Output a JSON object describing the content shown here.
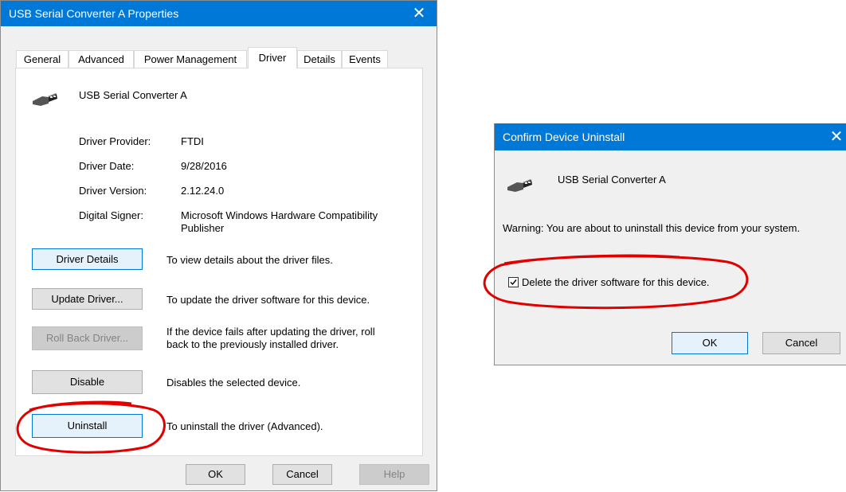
{
  "props_dialog": {
    "title": "USB Serial Converter A Properties",
    "tabs": [
      {
        "label": "General"
      },
      {
        "label": "Advanced"
      },
      {
        "label": "Power Management"
      },
      {
        "label": "Driver"
      },
      {
        "label": "Details"
      },
      {
        "label": "Events"
      }
    ],
    "active_tab": "Driver",
    "device_name": "USB Serial Converter A",
    "info": {
      "provider_label": "Driver Provider:",
      "provider_value": "FTDI",
      "date_label": "Driver Date:",
      "date_value": "9/28/2016",
      "version_label": "Driver Version:",
      "version_value": "2.12.24.0",
      "signer_label": "Digital Signer:",
      "signer_value_line1": "Microsoft Windows Hardware Compatibility",
      "signer_value_line2": "Publisher"
    },
    "actions": {
      "details_label": "Driver Details",
      "details_desc": "To view details about the driver files.",
      "update_label": "Update Driver...",
      "update_desc": "To update the driver software for this device.",
      "rollback_label": "Roll Back Driver...",
      "rollback_desc_line1": "If the device fails after updating the driver, roll",
      "rollback_desc_line2": "back to the previously installed driver.",
      "disable_label": "Disable",
      "disable_desc": "Disables the selected device.",
      "uninstall_label": "Uninstall",
      "uninstall_desc": "To uninstall the driver (Advanced)."
    },
    "footer": {
      "ok_label": "OK",
      "cancel_label": "Cancel",
      "help_label": "Help"
    }
  },
  "confirm_dialog": {
    "title": "Confirm Device Uninstall",
    "device_name": "USB Serial Converter A",
    "warning": "Warning: You are about to uninstall this device from your system.",
    "checkbox_label": "Delete the driver software for this device.",
    "checkbox_checked": true,
    "ok_label": "OK",
    "cancel_label": "Cancel"
  },
  "colors": {
    "title_bar": "#0078d7",
    "dialog_body": "#f0f0f0",
    "annotation_circle": "#e00000"
  }
}
